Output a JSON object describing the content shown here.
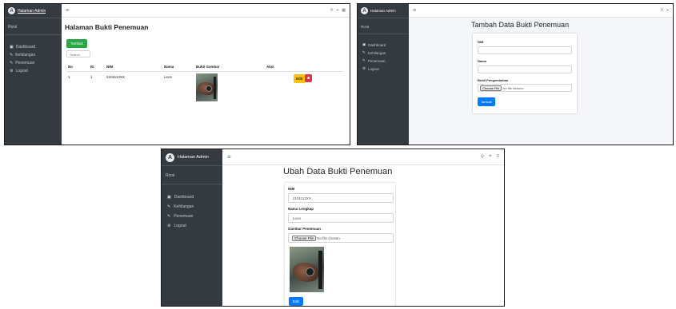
{
  "brand": {
    "name": "Halaman Admin",
    "logo_letter": "A"
  },
  "user": {
    "name": "Rizal"
  },
  "nav": [
    {
      "icon": "dashboard-icon",
      "label": "Dashboard"
    },
    {
      "icon": "edit-icon",
      "label": "Kehilangan"
    },
    {
      "icon": "edit-icon",
      "label": "Penemuan"
    },
    {
      "icon": "gear-icon",
      "label": "Logout"
    }
  ],
  "topbar": {
    "menu_icon": "hamburger-icon",
    "right_icons": [
      "search-icon",
      "expand-icon",
      "grid-icon"
    ]
  },
  "panel1": {
    "title": "Halaman Bukti Penemuan",
    "add_button": "Tambah",
    "search_placeholder": "Search",
    "table": {
      "headers": [
        "No",
        "ID",
        "NIM",
        "Nama",
        "Bukti Gambar",
        "Aksi"
      ],
      "rows": [
        {
          "no": "1",
          "id": "1",
          "nim": "2101113XX",
          "nama": "Leon",
          "edit": "Edit",
          "delete_icon": "trash-icon"
        }
      ]
    }
  },
  "panel2": {
    "title": "Tambah Data Bukti Penemuan",
    "nim_label": "NIM",
    "nama_label": "Nama",
    "gambar_label": "Bukti Pengembalian",
    "file_button": "Choose File",
    "file_status": "No file chosen",
    "submit": "Tambah"
  },
  "panel3": {
    "title": "Ubah Data Bukti Penemuan",
    "nim_label": "NIM",
    "nim_value": "2101113XX",
    "nama_label": "Nama Lengkap",
    "nama_value": "Leon",
    "gambar_label": "Gambar Penemuan",
    "file_button": "Choose File",
    "file_status": "No file chosen",
    "submit": "Edit"
  }
}
